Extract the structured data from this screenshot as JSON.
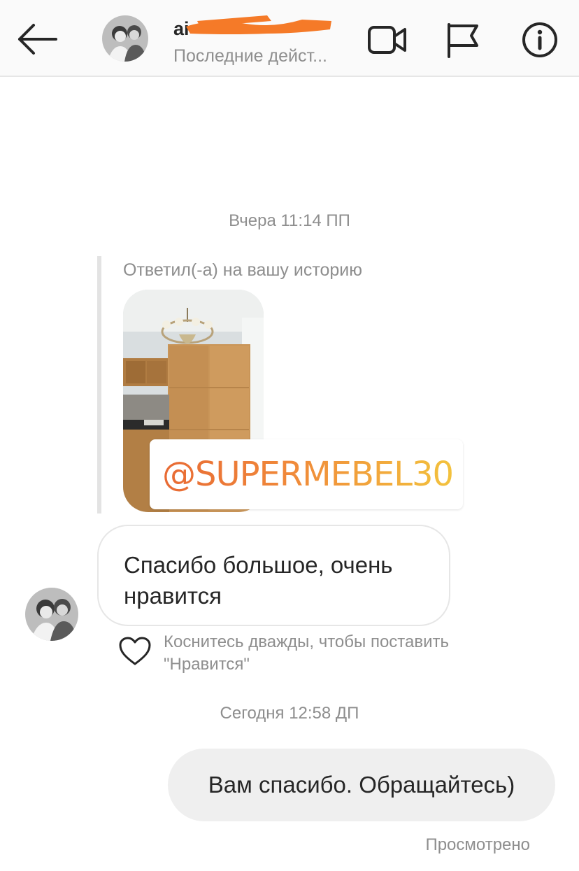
{
  "header": {
    "username": "ai",
    "presence": "Последние дейст...",
    "back_icon": "arrow-left-icon",
    "video_icon": "video-camera-icon",
    "flag_icon": "flag-icon",
    "info_icon": "info-icon"
  },
  "messages": {
    "yesterday_time": "Вчера 11:14 ПП",
    "story_reply_label": "Ответил(-а) на вашу историю",
    "mention": "@SUPERMEBEL30",
    "incoming_text": "Спасибо большое, очень нравится",
    "like_hint": "Коснитесь дважды, чтобы поставить \"Нравится\"",
    "today_time": "Сегодня 12:58 ДП",
    "outgoing_text": "Вам спасибо. Обращайтесь)",
    "seen_status": "Просмотрено"
  },
  "colors": {
    "redaction": "#f57a28",
    "mention_gradient_start": "#e86a34",
    "mention_gradient_end": "#f3c23d",
    "outgoing_bubble": "#efefef"
  }
}
